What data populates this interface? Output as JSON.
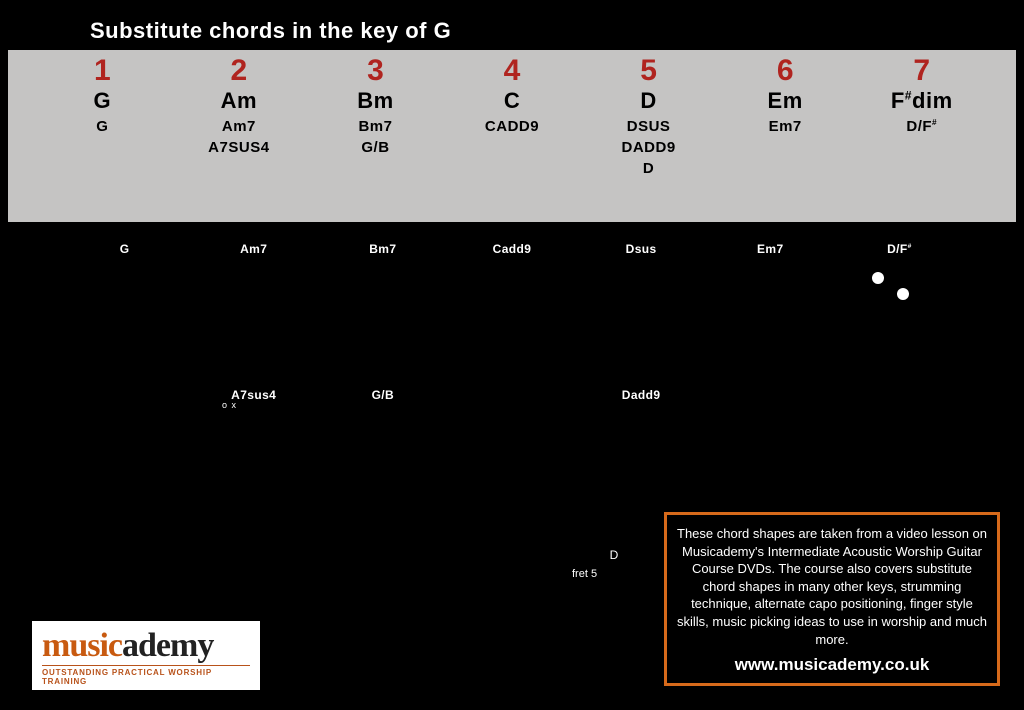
{
  "title": "Substitute chords in the key of G",
  "degrees": [
    {
      "num": "1",
      "main": "G",
      "subs": [
        "G"
      ]
    },
    {
      "num": "2",
      "main": "Am",
      "subs": [
        "Am7",
        "A7SUS4"
      ]
    },
    {
      "num": "3",
      "main": "Bm",
      "subs": [
        "Bm7",
        "G/B"
      ]
    },
    {
      "num": "4",
      "main": "C",
      "subs": [
        "CADD9"
      ]
    },
    {
      "num": "5",
      "main": "D",
      "subs": [
        "DSUS",
        "DADD9",
        "D"
      ]
    },
    {
      "num": "6",
      "main": "Em",
      "subs": [
        "Em7"
      ]
    },
    {
      "num": "7",
      "main": "F#dim",
      "subs": [
        "D/F#"
      ]
    }
  ],
  "diag_row1": [
    "G",
    "Am7",
    "Bm7",
    "Cadd9",
    "Dsus",
    "Em7",
    "D/F#"
  ],
  "diag_row2": [
    "",
    "A7sus4",
    "G/B",
    "",
    "Dadd9",
    "",
    ""
  ],
  "xo_marks": "o x",
  "d_label": "D",
  "fret_label": "fret 5",
  "infobox": {
    "text": "These chord shapes are taken from a video lesson on Musicademy's Intermediate Acoustic Worship Guitar Course DVDs. The course also covers substitute chord shapes in many other keys, strumming technique, alternate capo positioning, finger style skills, music picking ideas to use in worship and much more.",
    "url": "www.musicademy.co.uk"
  },
  "logo": {
    "brand_accent": "music",
    "brand_rest": "ademy",
    "tagline": "OUTSTANDING PRACTICAL WORSHIP TRAINING"
  }
}
